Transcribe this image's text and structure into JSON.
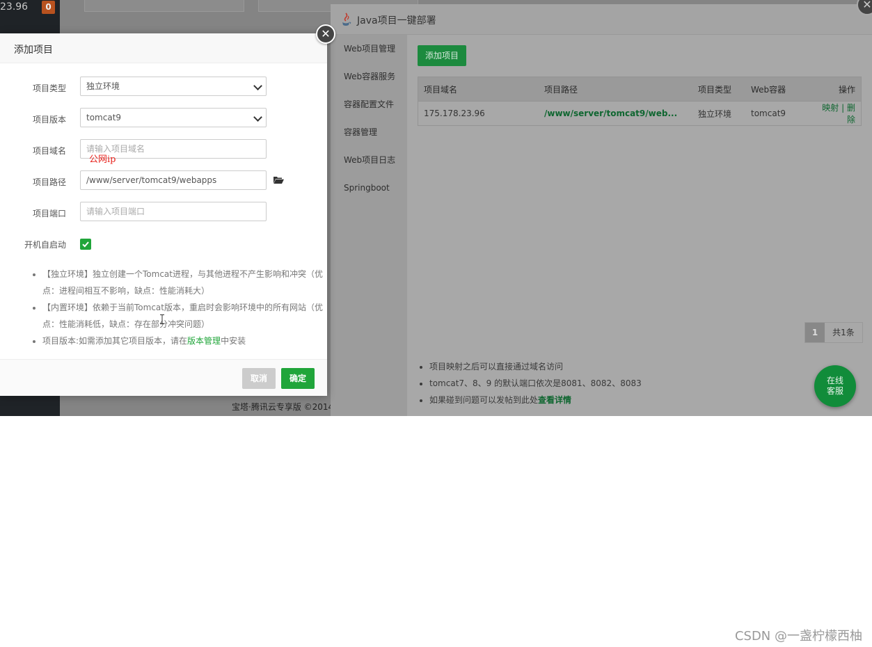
{
  "background": {
    "ip_fragment": "23.96",
    "badge": "0",
    "footer_text": "宝塔·腾讯云专享版 ©2014"
  },
  "java_panel": {
    "title": "Java项目一键部署",
    "icon": "java-icon",
    "nav": [
      "Web项目管理",
      "Web容器服务",
      "容器配置文件",
      "容器管理",
      "Web项目日志",
      "Springboot"
    ],
    "add_button": "添加项目",
    "table": {
      "headers": [
        "项目域名",
        "项目路径",
        "项目类型",
        "Web容器",
        "操作"
      ],
      "rows": [
        {
          "domain": "175.178.23.96",
          "path": "/www/server/tomcat9/web...",
          "type": "独立环境",
          "container": "tomcat9",
          "map": "映射",
          "sep": "|",
          "delete": "删除"
        }
      ]
    },
    "pager": {
      "current": "1",
      "total": "共1条"
    },
    "tips": [
      {
        "text": "项目映射之后可以直接通过域名访问",
        "link": ""
      },
      {
        "text": "tomcat7、8、9 的默认端口依次是8081、8082、8083",
        "link": ""
      },
      {
        "text": "如果碰到问题可以发帖到此处",
        "link": "查看详情"
      }
    ]
  },
  "online_service": {
    "line1": "在线",
    "line2": "客服"
  },
  "dialog": {
    "title": "添加项目",
    "fields": {
      "type": {
        "label": "项目类型",
        "value": "独立环境"
      },
      "version": {
        "label": "项目版本",
        "value": "tomcat9"
      },
      "domain": {
        "label": "项目域名",
        "placeholder": "请输入项目域名"
      },
      "path": {
        "label": "项目路径",
        "value": "/www/server/tomcat9/webapps"
      },
      "port": {
        "label": "项目端口",
        "placeholder": "请输入项目端口"
      },
      "autostart": {
        "label": "开机自启动",
        "checked": true
      }
    },
    "annotation": "公网ip",
    "notes": [
      {
        "text": "【独立环境】独立创建一个Tomcat进程，与其他进程不产生影响和冲突（优点：进程间相互不影响，缺点：性能消耗大）"
      },
      {
        "text": "【内置环境】依赖于当前Tomcat版本，重启时会影响环境中的所有网站（优点：性能消耗低，缺点：存在部分冲突问题）"
      },
      {
        "pre": "项目版本:如需添加其它项目版本，请在",
        "link": "版本管理",
        "post": "中安装"
      }
    ],
    "cancel": "取消",
    "confirm": "确定"
  },
  "watermark": "CSDN @一盏柠檬西柚",
  "colors": {
    "accent": "#20a53a",
    "dim_accent": "#1c8a3e",
    "overlay": "#7b7b7b"
  }
}
